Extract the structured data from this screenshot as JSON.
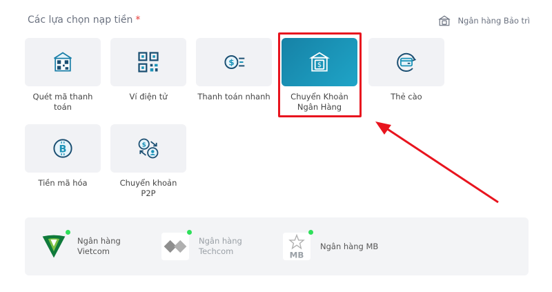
{
  "section": {
    "title": "Các lựa chọn nạp tiền",
    "required_mark": "*"
  },
  "maintenance": {
    "label": "Ngân hàng Bảo trì",
    "icon": "bank-maintenance-icon"
  },
  "options": [
    {
      "label": "Quét mã thanh toán",
      "icon": "qr-scan-icon"
    },
    {
      "label": "Ví điện tử",
      "icon": "qr-code-icon"
    },
    {
      "label": "Thanh toán nhanh",
      "icon": "fast-pay-icon"
    },
    {
      "label": "Chuyển Khoản Ngân Hàng",
      "icon": "bank-icon",
      "selected": true
    },
    {
      "label": "Thẻ cào",
      "icon": "card-icon"
    },
    {
      "label": "Tiền mã hóa",
      "icon": "bitcoin-icon"
    },
    {
      "label": "Chuyển khoản P2P",
      "icon": "p2p-icon"
    }
  ],
  "banks": [
    {
      "name": "Ngân hàng Vietcom",
      "status": "online"
    },
    {
      "name": "Ngân hàng Techcom",
      "status": "online"
    },
    {
      "name": "Ngân hàng MB",
      "logo_text": "MB",
      "status": "online"
    }
  ],
  "colors": {
    "accent": "#1b93b8",
    "highlight": "#e8141e",
    "online": "#2ee05a"
  }
}
